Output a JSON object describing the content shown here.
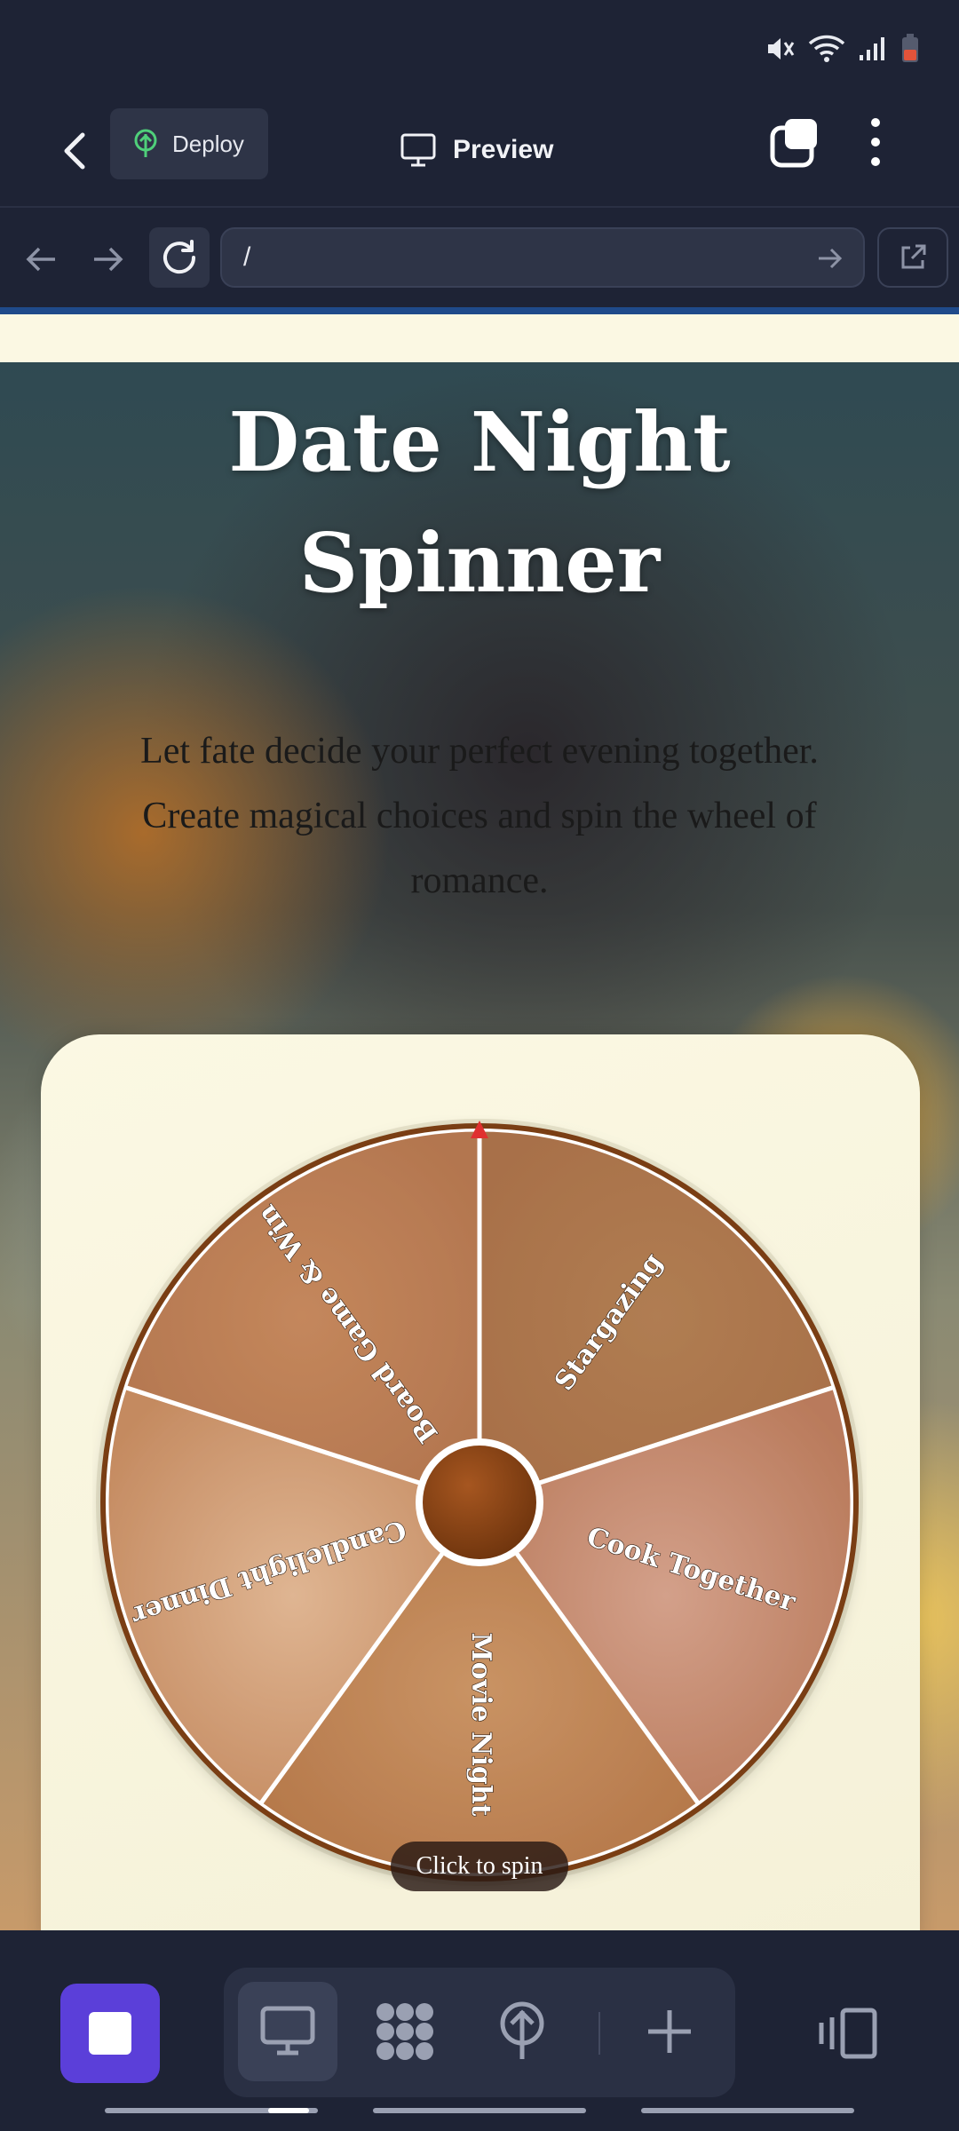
{
  "app_bar": {
    "deploy_label": "Deploy",
    "preview_label": "Preview"
  },
  "url_bar": {
    "value": "/"
  },
  "page": {
    "title_line1": "Date Night",
    "title_line2": "Spinner",
    "subtitle_line1": "Let fate decide your perfect evening together.",
    "subtitle_line2": "Create magical choices and spin the wheel of",
    "subtitle_line3": "romance.",
    "spin_label": "Click to spin"
  },
  "wheel": {
    "segments": [
      {
        "label": "Stargazing",
        "color_a": "#b07d52",
        "color_b": "#a87049"
      },
      {
        "label": "Cook Together",
        "color_a": "#d3a08a",
        "color_b": "#b97a5b"
      },
      {
        "label": "Movie Night",
        "color_a": "#c99364",
        "color_b": "#b5784a"
      },
      {
        "label": "Candlelight Dinner",
        "color_a": "#dfb592",
        "color_b": "#c48a60"
      },
      {
        "label": "Board Game & Win",
        "color_a": "#c4875c",
        "color_b": "#b3764f"
      }
    ],
    "rim_color": "#7a3e14",
    "hub_color": "#8b4413",
    "pointer_color": "#e03030"
  },
  "colors": {
    "chrome_bg": "#1e2335",
    "accent": "#5b3fd9"
  }
}
